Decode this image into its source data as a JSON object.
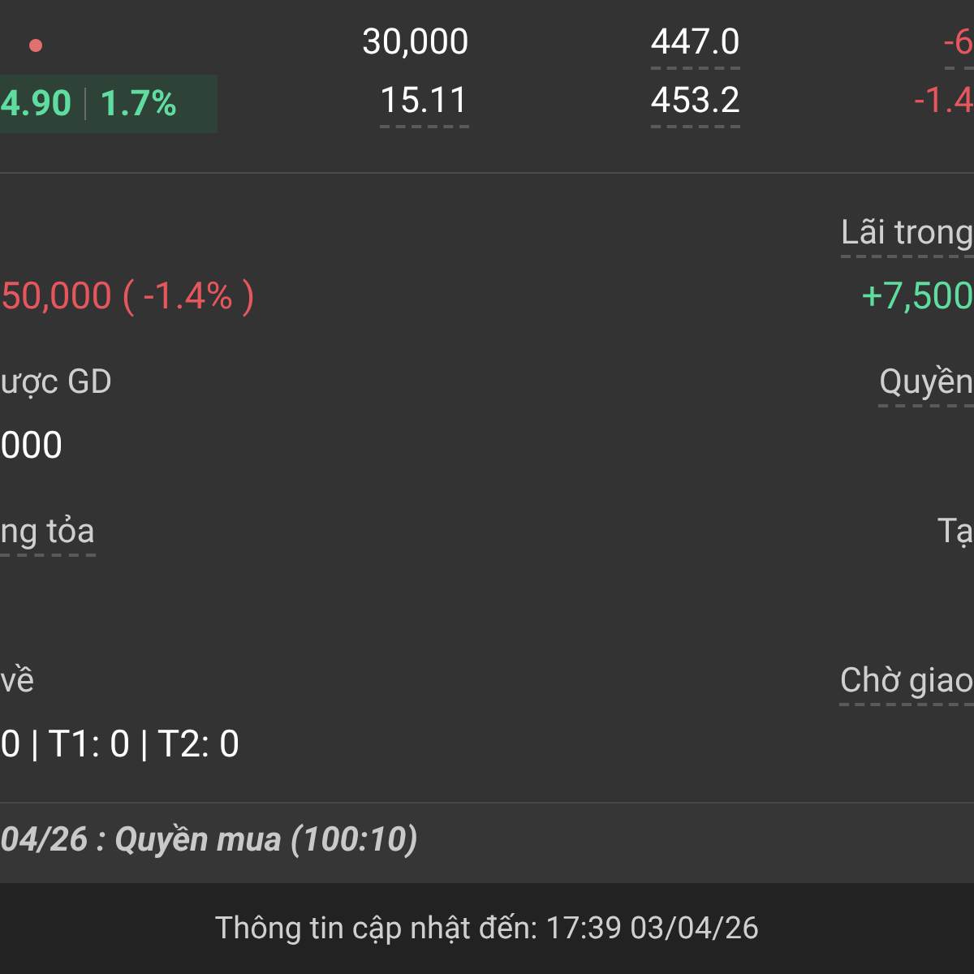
{
  "quote": {
    "change": "4.90",
    "change_percent": "1.7%",
    "columns": [
      {
        "top": {
          "text": "30,000",
          "hint": false
        },
        "bottom": {
          "text": "15.11",
          "hint": true
        }
      },
      {
        "top": {
          "text": "447.0",
          "hint": true
        },
        "bottom": {
          "text": "453.2",
          "hint": true
        }
      },
      {
        "top": {
          "text": "-6",
          "hint": true,
          "color": "#e5575d"
        },
        "bottom": {
          "text": "-1.4",
          "hint": false,
          "color": "#e5575d"
        }
      }
    ]
  },
  "details": [
    {
      "left": {
        "value": "50,000 ( -1.4% )",
        "color": "#e5575d"
      },
      "right": {
        "label": "Lãi trong",
        "hint": true,
        "value": "+7,500",
        "color": "#5fdca0"
      }
    },
    {
      "left": {
        "label": "ược GD",
        "hint": false,
        "value": "000"
      },
      "right": {
        "label": "Quyền",
        "hint": true
      }
    },
    {
      "left": {
        "label": "ng tỏa",
        "hint": true
      },
      "right": {
        "label": "Tạ",
        "hint": false
      }
    },
    {
      "left": {
        "label": "về",
        "hint": false,
        "value": "0 | T1: 0 | T2: 0"
      },
      "right": {
        "label": "Chờ giao",
        "hint": true
      }
    }
  ],
  "event": "04/26 : Quyền mua (100:10)",
  "footer": "Thông tin cập nhật đến: 17:39 03/04/26"
}
